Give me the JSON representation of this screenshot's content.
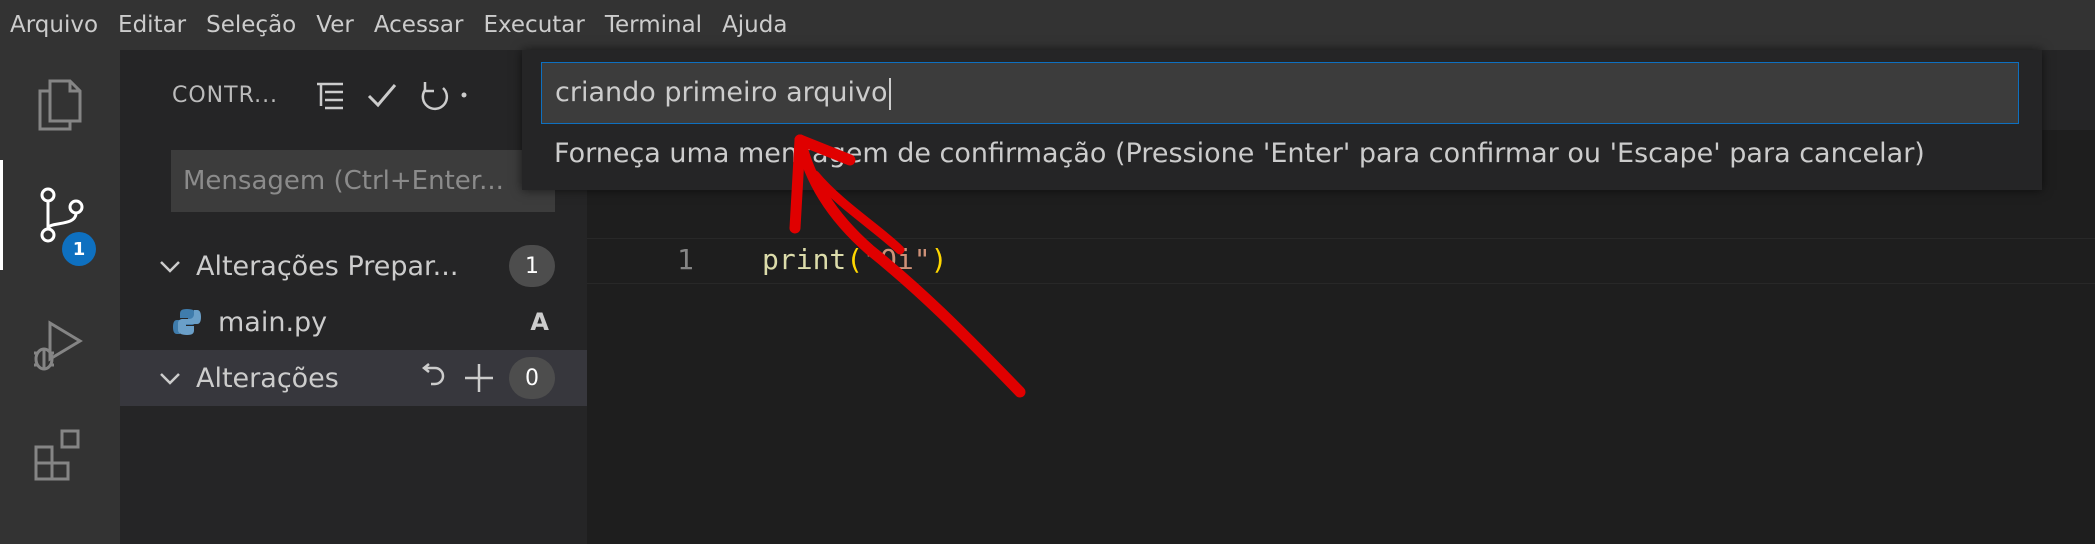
{
  "menubar": {
    "items": [
      "Arquivo",
      "Editar",
      "Seleção",
      "Ver",
      "Acessar",
      "Executar",
      "Terminal",
      "Ajuda"
    ]
  },
  "activitybar": {
    "items": [
      {
        "name": "explorer",
        "icon": "files-icon"
      },
      {
        "name": "source-control",
        "icon": "source-control-icon",
        "badge": "1"
      },
      {
        "name": "run-debug",
        "icon": "run-debug-icon"
      },
      {
        "name": "extensions",
        "icon": "extensions-icon"
      }
    ]
  },
  "sidebar": {
    "title": "CONTR...",
    "actions": [
      "list-tree-icon",
      "check-icon",
      "refresh-icon",
      "more-icon"
    ],
    "message_placeholder": "Mensagem (Ctrl+Enter...",
    "staged": {
      "label": "Alterações Prepar...",
      "count": "1"
    },
    "file": {
      "name": "main.py",
      "status": "A"
    },
    "changes": {
      "label": "Alterações",
      "count": "0"
    }
  },
  "editor": {
    "line_number": "1",
    "code": {
      "fn": "print",
      "open": "(",
      "str": "\"Oi\"",
      "close": ")"
    }
  },
  "quick_input": {
    "value": "criando primeiro arquivo",
    "message": "Forneça uma mensagem de confirmação (Pressione 'Enter' para confirmar ou 'Escape' para cancelar)"
  },
  "colors": {
    "accent": "#0e70c0",
    "annotation": "#e00000"
  }
}
